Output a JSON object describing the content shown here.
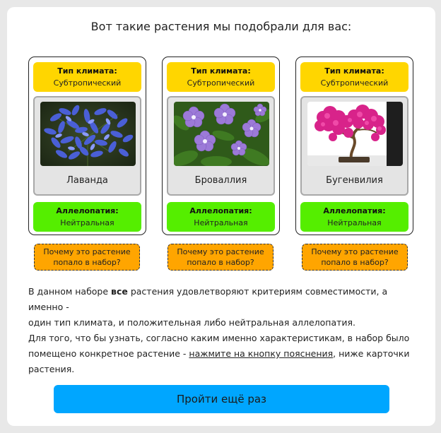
{
  "header": {
    "title": "Вот такие растения мы подобрали для вас:"
  },
  "cards": [
    {
      "climate_label": "Тип климата:",
      "climate_value": "Субтропический",
      "name": "Лаванда",
      "allelopathy_label": "Аллелопатия:",
      "allelopathy_value": "Нейтральная",
      "photo_icon": "agapanthus-flower-photo"
    },
    {
      "climate_label": "Тип климата:",
      "climate_value": "Субтропический",
      "name": "Броваллия",
      "allelopathy_label": "Аллелопатия:",
      "allelopathy_value": "Нейтральная",
      "photo_icon": "browallia-flower-photo"
    },
    {
      "climate_label": "Тип климата:",
      "climate_value": "Субтропический",
      "name": "Бугенвилия",
      "allelopathy_label": "Аллелопатия:",
      "allelopathy_value": "Нейтральная",
      "photo_icon": "bougainvillea-bonsai-photo"
    }
  ],
  "why_button": {
    "line1": "Почему это растение",
    "line2": "попало в набор?"
  },
  "info": {
    "p1_part1": "В данном наборе ",
    "p1_bold": "все",
    "p1_part2": " растения удовлетворяют критериям совместимости, а именно -",
    "p1_line2": "один тип климата, и положительная либо нейтральная аллелопатия.",
    "p2_part1": "Для того, что бы узнать, согласно каким именно характеристикам, в набор было",
    "p2_part2": "помещено конкретное растение - ",
    "p2_link": "нажмите на кнопку пояснения",
    "p2_part3": ", ниже карточки",
    "p2_part4": "растения."
  },
  "actions": {
    "retry_label": "Пройти ещё раз"
  },
  "colors": {
    "climate_bg": "#ffd600",
    "allelopathy_bg": "#55ee00",
    "why_button_bg": "#ffa500",
    "retry_button_bg": "#00a6ff"
  }
}
